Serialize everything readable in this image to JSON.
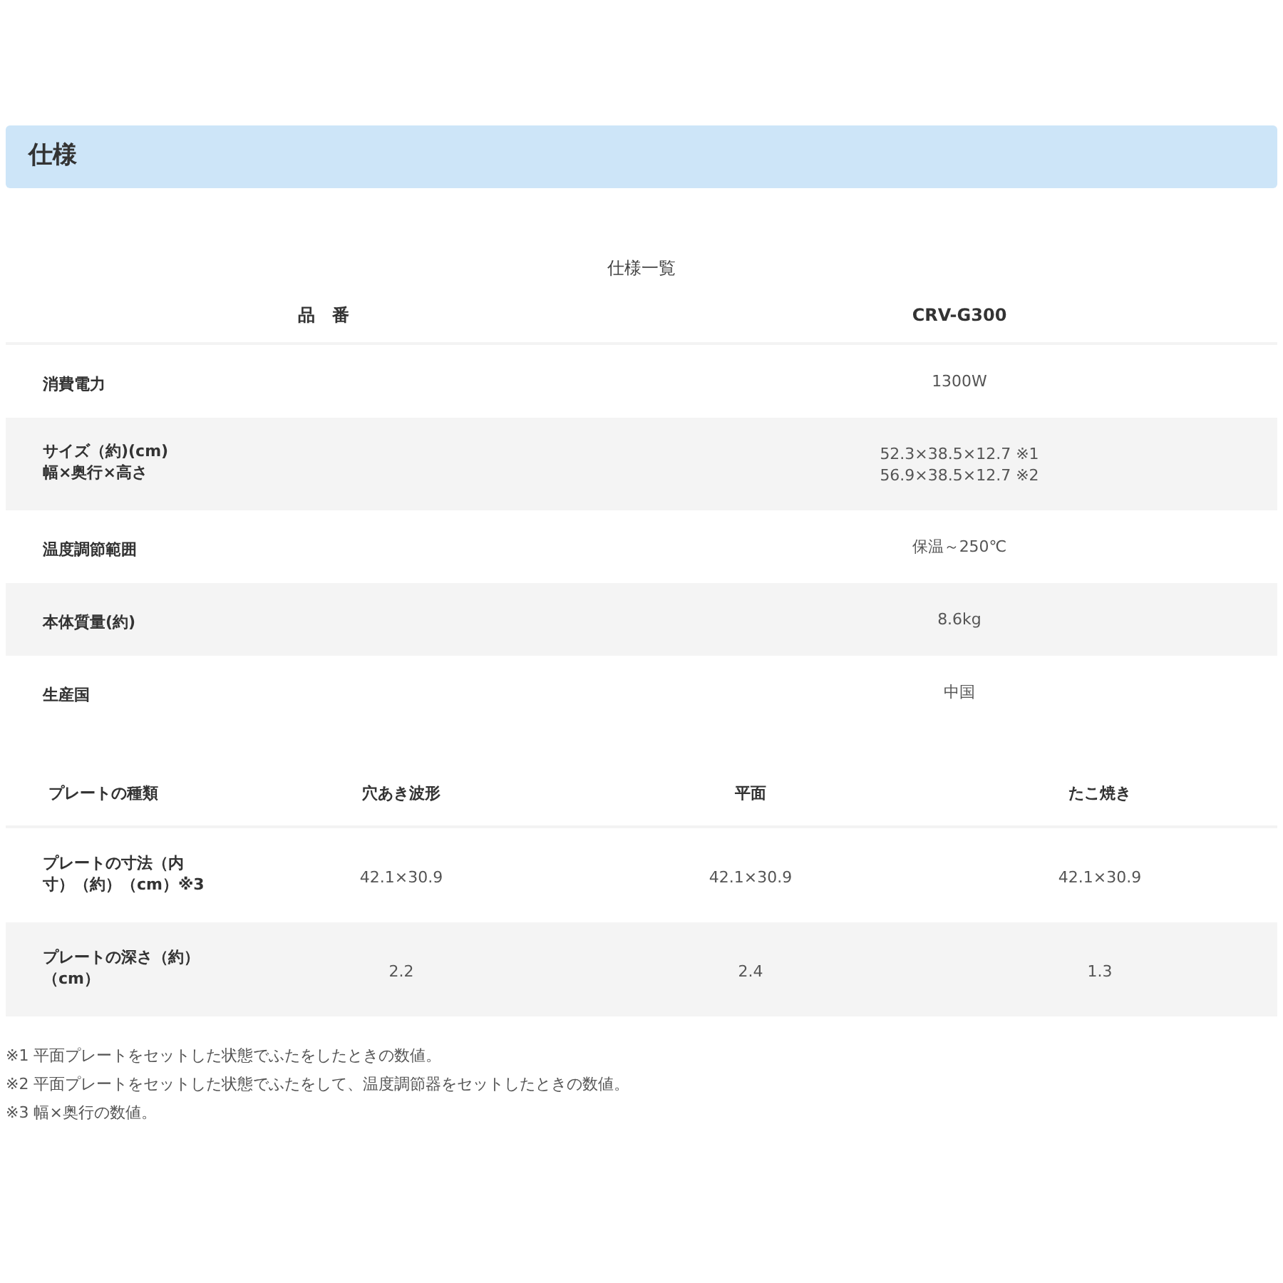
{
  "section_title": "仕様",
  "spec_table": {
    "caption": "仕様一覧",
    "columns": [
      "品　番",
      "CRV-G300"
    ],
    "rows": [
      {
        "label": [
          "消費電力"
        ],
        "value": [
          "1300W"
        ]
      },
      {
        "label": [
          "サイズ（約)(cm)",
          "幅×奥行×高さ"
        ],
        "value": [
          "52.3×38.5×12.7 ※1",
          "56.9×38.5×12.7 ※2"
        ]
      },
      {
        "label": [
          "温度調節範囲"
        ],
        "value": [
          "保温～250℃"
        ]
      },
      {
        "label": [
          "本体質量(約)"
        ],
        "value": [
          "8.6kg"
        ]
      },
      {
        "label": [
          "生産国"
        ],
        "value": [
          "中国"
        ]
      }
    ]
  },
  "plate_table": {
    "columns": [
      "プレートの種類",
      "穴あき波形",
      "平面",
      "たこ焼き"
    ],
    "rows": [
      {
        "label": [
          "プレートの寸法（内",
          "寸）（約）（cm）※3"
        ],
        "values": [
          "42.1×30.9",
          "42.1×30.9",
          "42.1×30.9"
        ]
      },
      {
        "label": [
          "プレートの深さ（約）",
          "（cm）"
        ],
        "values": [
          "2.2",
          "2.4",
          "1.3"
        ]
      }
    ]
  },
  "notes": [
    "※1 平面プレートをセットした状態でふたをしたときの数値。",
    "※2 平面プレートをセットした状態でふたをして、温度調節器をセットしたときの数値。",
    "※3 幅×奥行の数値。"
  ]
}
